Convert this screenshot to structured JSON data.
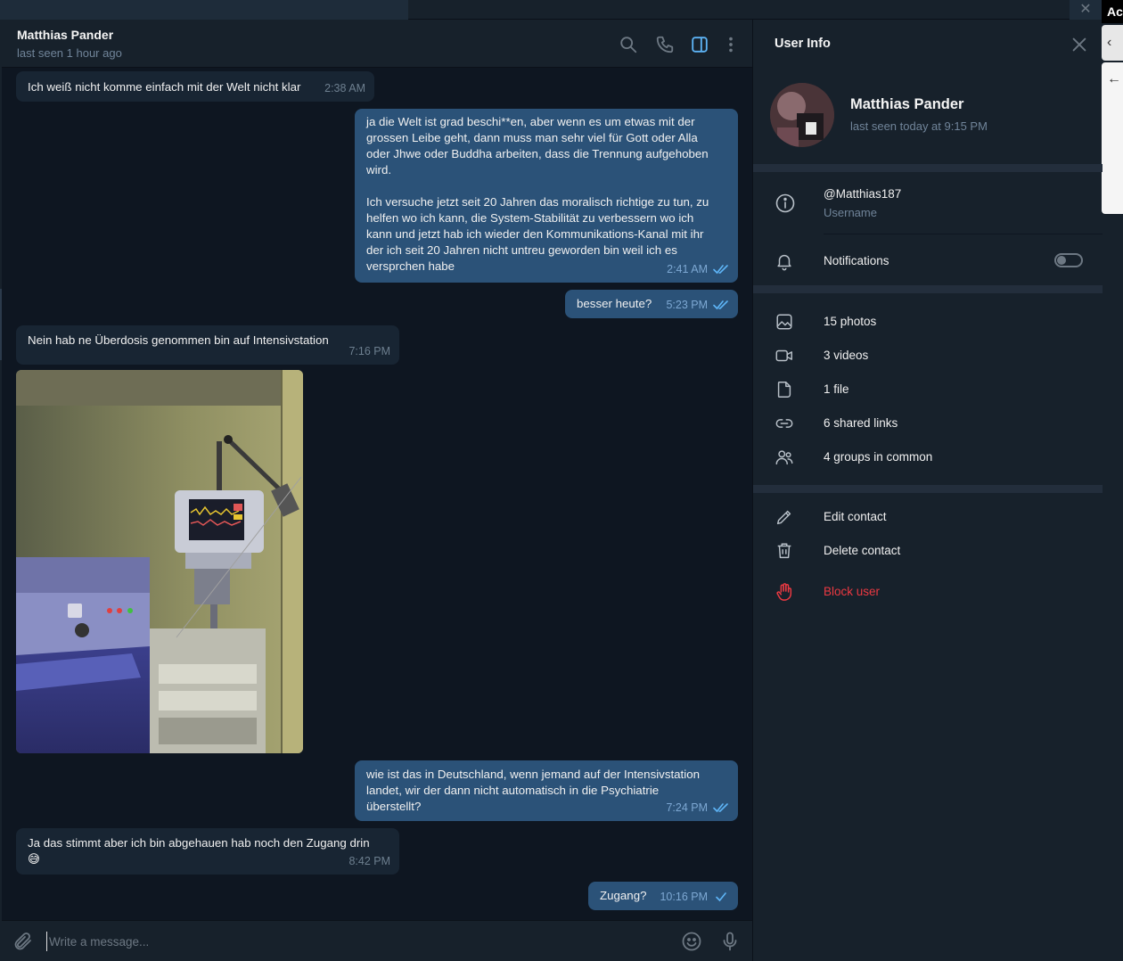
{
  "chat": {
    "name": "Matthias Pander",
    "status": "last seen 1 hour ago"
  },
  "edge": {
    "label": "Ac",
    "back1": "‹",
    "back2": "←"
  },
  "messages": [
    {
      "dir": "in",
      "text": "Ich weiß nicht komme einfach mit der Welt nicht klar",
      "time": "2:38 AM"
    },
    {
      "dir": "out",
      "text": "ja die Welt ist grad beschi**en, aber wenn es um etwas mit der\ngrossen Leibe geht, dann muss man sehr viel für Gott oder Alla\noder Jhwe oder Buddha arbeiten, dass die Trennung aufgehoben\nwird.\n\nIch versuche jetzt seit 20 Jahren das moralisch richtige zu tun, zu\nhelfen wo ich kann, die System-Stabilität zu verbessern wo ich\nkann und jetzt hab ich wieder den Kommunikations-Kanal mit ihr\nder ich seit 20 Jahren nicht untreu geworden bin weil ich es\nversprchen habe",
      "time": "2:41 AM",
      "status": "read"
    },
    {
      "dir": "out",
      "text": "besser heute?",
      "time": "5:23 PM",
      "status": "read"
    },
    {
      "dir": "in",
      "text": "Nein hab ne Überdosis genommen bin auf Intensivstation",
      "time": "7:16 PM"
    },
    {
      "dir": "out",
      "text": "wie ist das in Deutschland, wenn jemand auf der Intensivstation\nlandet, wir der dann nicht automatisch in die Psychiatrie\nüberstellt?",
      "time": "7:24 PM",
      "status": "read"
    },
    {
      "dir": "in",
      "text": "Ja das stimmt aber ich bin abgehauen hab noch den Zugang drin\n😅",
      "time": "8:42 PM"
    },
    {
      "dir": "out",
      "text": "Zugang?",
      "time": "10:16 PM",
      "status": "sent"
    }
  ],
  "composer": {
    "placeholder": "Write a message..."
  },
  "info": {
    "title": "User Info",
    "name": "Matthias Pander",
    "seen": "last seen today at 9:15 PM",
    "username": "@Matthias187",
    "username_label": "Username",
    "notifications_label": "Notifications",
    "notifications_on": false,
    "media": [
      {
        "icon": "photo-icon",
        "label": "15 photos"
      },
      {
        "icon": "video-icon",
        "label": "3 videos"
      },
      {
        "icon": "file-icon",
        "label": "1 file"
      },
      {
        "icon": "link-icon",
        "label": "6 shared links"
      },
      {
        "icon": "groups-icon",
        "label": "4 groups in common"
      }
    ],
    "actions": [
      {
        "icon": "pencil-icon",
        "label": "Edit contact",
        "color": "#f0f0f0"
      },
      {
        "icon": "trash-icon",
        "label": "Delete contact",
        "color": "#f0f0f0"
      },
      {
        "icon": "hand-icon",
        "label": "Block user",
        "color": "#ec3942"
      }
    ]
  },
  "colors": {
    "accent": "#5eb5f7",
    "incoming_bubble": "#182533",
    "outgoing_bubble": "#2b5278",
    "danger": "#ec3942"
  }
}
